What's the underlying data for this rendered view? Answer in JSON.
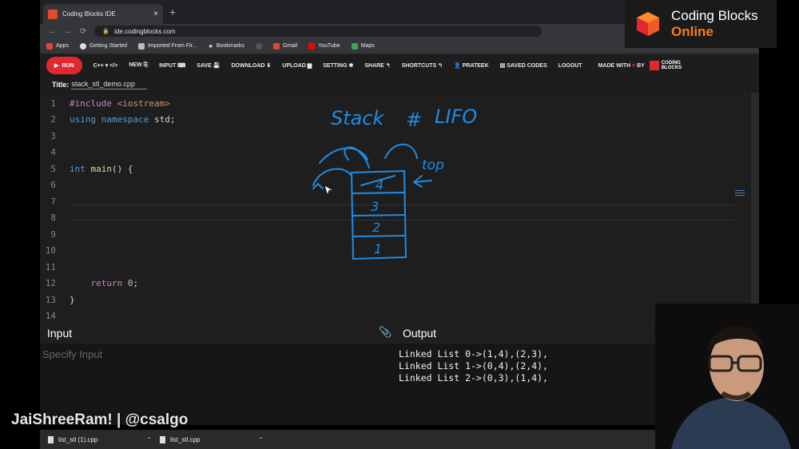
{
  "browser": {
    "tab_title": "Coding Blocks IDE",
    "tab_close": "×",
    "new_tab": "+",
    "url": "ide.codingblocks.com",
    "bookmarks": [
      "Apps",
      "Getting Started",
      "Imported From Fir...",
      "Bookmarks",
      "Gmail",
      "YouTube",
      "Maps"
    ]
  },
  "toolbar": {
    "run": "RUN",
    "language": "C++ ▾ </>",
    "new": "NEW ⎘",
    "input": "INPUT ⌨",
    "save": "SAVE 💾",
    "download": "DOWNLOAD ⬇",
    "upload": "UPLOAD ▆",
    "setting": "SETTING ✱",
    "share": "SHARE ↰",
    "shortcuts": "SHORTCUTS ↰",
    "user": "👤 PRATEEK",
    "saved_codes": "▤ SAVED CODES",
    "logout": "LOGOUT",
    "made_with": "MADE WITH",
    "by": "BY",
    "brand_small_1": "CODING",
    "brand_small_2": "BLOCKS"
  },
  "file": {
    "title_label": "Title:",
    "title_value": "stack_stl_demo.cpp"
  },
  "editor": {
    "line_numbers": [
      "1",
      "2",
      "3",
      "4",
      "5",
      "6",
      "7",
      "8",
      "9",
      "10",
      "11",
      "12",
      "13",
      "14"
    ],
    "code": {
      "l1_a": "#include",
      "l1_b": " <iostream>",
      "l2_a": "using",
      "l2_b": " namespace",
      "l2_c": " std;",
      "l5_a": "int",
      "l5_b": " main",
      "l5_c": "() {",
      "l12_a": "    return",
      "l12_b": " 0",
      "l12_c": ";",
      "l13": "}"
    }
  },
  "drawing": {
    "title_left": "Stack",
    "title_mid": "#",
    "title_right": "LIFO",
    "top_label": "top",
    "cells": [
      "4",
      "3",
      "2",
      "1"
    ]
  },
  "io": {
    "input_label": "Input",
    "output_label": "Output",
    "input_placeholder": "Specify Input",
    "output_lines": [
      "Linked List 0->(1,4),(2,3),",
      "Linked List 1->(0,4),(2,4),",
      "Linked List 2->(0,3),(1,4),"
    ]
  },
  "downloads": [
    "list_stl (1).cpp",
    "list_stl.cpp"
  ],
  "overlay": {
    "brand_line1": "Coding Blocks",
    "brand_line2": "Online",
    "watermark": "JaiShreeRam! | @csalgo"
  },
  "colors": {
    "run_red": "#e0282e",
    "ink_blue": "#1e8ce6",
    "brand_orange": "#ff7a1a"
  }
}
